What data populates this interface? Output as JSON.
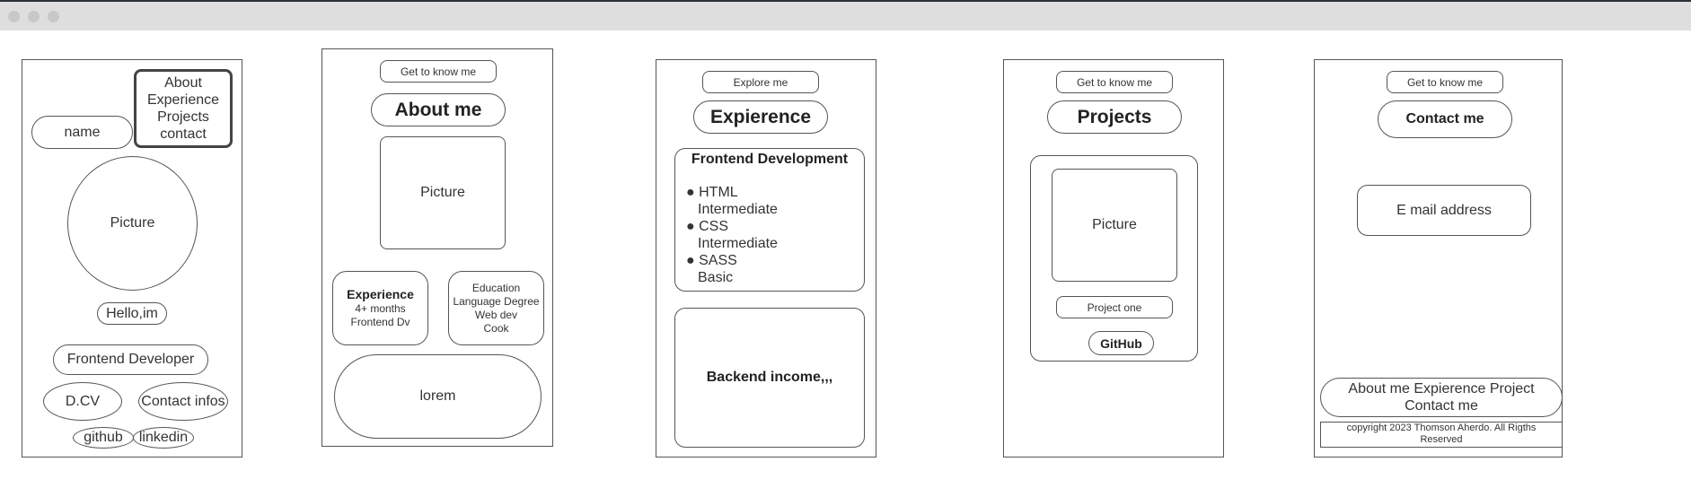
{
  "window": {
    "controls": [
      "close",
      "minimize",
      "maximize"
    ]
  },
  "screen1": {
    "menu": [
      "About",
      "Experience",
      "Projects",
      "contact"
    ],
    "name": "name",
    "picture": "Picture",
    "greeting": "Hello,im",
    "role": "Frontend Developer",
    "cv": "D.CV",
    "contact": "Contact infos",
    "github": "github",
    "linkedin": "linkedin"
  },
  "screen2": {
    "tag": "Get to know me",
    "title": "About me",
    "picture": "Picture",
    "experience": {
      "title": "Experience",
      "lines": [
        "4+ months",
        "Frontend Dv"
      ]
    },
    "education": {
      "title": "Education",
      "lines": [
        "Language Degree",
        "Web dev",
        "Cook"
      ]
    },
    "lorem": "lorem"
  },
  "screen3": {
    "tag": "Explore me",
    "title": "Expierence",
    "frontend": {
      "title": "Frontend Development",
      "skills": [
        {
          "name": "HTML",
          "level": "Intermediate"
        },
        {
          "name": "CSS",
          "level": "Intermediate"
        },
        {
          "name": "SASS",
          "level": "Basic"
        }
      ]
    },
    "backend": "Backend income,,,"
  },
  "screen4": {
    "tag": "Get to know me",
    "title": "Projects",
    "picture": "Picture",
    "project": "Project one",
    "github": "GitHub"
  },
  "screen5": {
    "tag": "Get to know me",
    "title": "Contact me",
    "email": "E mail address",
    "footer_nav": "About me Expierence Project Contact me",
    "copyright": "copyright 2023 Thomson Aherdo. All Rigths Reserved"
  }
}
